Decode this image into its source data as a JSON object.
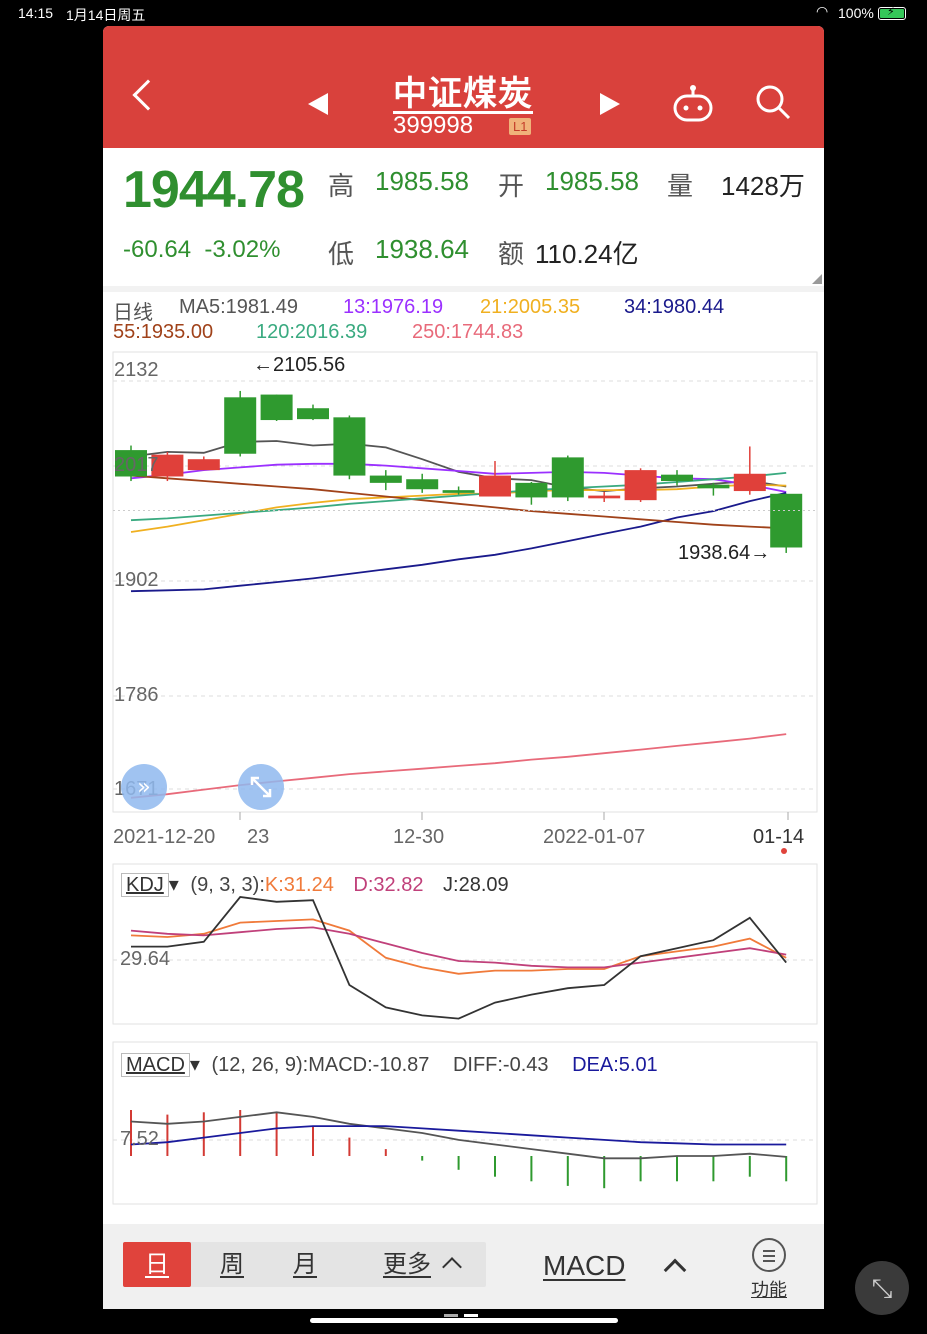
{
  "status_bar": {
    "time": "14:15",
    "date": "1月14日周五",
    "battery": "100%"
  },
  "header": {
    "title": "中证煤炭",
    "code": "399998",
    "level_badge": "L1",
    "bg_color": "#d9413c"
  },
  "quote": {
    "price": "1944.78",
    "change": "-60.64",
    "change_pct": "-3.02%",
    "high_label": "高",
    "high": "1985.58",
    "open_label": "开",
    "open": "1985.58",
    "volume_label": "量",
    "volume": "1428万",
    "low_label": "低",
    "low": "1938.64",
    "amount_label": "额",
    "amount": "110.24亿",
    "down_color": "#2f8f2f"
  },
  "kline": {
    "period_label": "日线",
    "ma": [
      {
        "label": "MA5:1981.49",
        "color": "#555555"
      },
      {
        "label": "13:1976.19",
        "color": "#9b30ff"
      },
      {
        "label": "21:2005.35",
        "color": "#f0b020"
      },
      {
        "label": "34:1980.44",
        "color": "#1a1a8c"
      },
      {
        "label": "55:1935.00",
        "color": "#a0421a"
      },
      {
        "label": "120:2016.39",
        "color": "#3aaa80"
      },
      {
        "label": "250:1744.83",
        "color": "#e86a7a"
      }
    ],
    "y_ticks": [
      "2132",
      "2017",
      "1902",
      "1786",
      "1671"
    ],
    "high_marker": "←2105.56",
    "low_marker": "1938.64→",
    "x_ticks": [
      "2021-12-20",
      "23",
      "12-30",
      "2022-01-07",
      "01-14"
    ]
  },
  "kdj": {
    "name": "KDJ",
    "params": "(9, 3, 3):",
    "k": "K:31.24",
    "d": "D:32.82",
    "j": "J:28.09",
    "tick": "29.64"
  },
  "macd": {
    "name": "MACD",
    "params": "(12, 26, 9):",
    "macd": "MACD:-10.87",
    "diff": "DIFF:-0.43",
    "dea": "DEA:5.01",
    "tick": "7.52"
  },
  "bottom_bar": {
    "tabs": [
      "日",
      "周",
      "月",
      "更多"
    ],
    "indicator": "MACD",
    "func_label": "功能"
  },
  "chart_data": [
    {
      "type": "candlestick",
      "title": "中证煤炭 日线",
      "x": [
        "2021-12-20",
        "2021-12-21",
        "2021-12-22",
        "2021-12-23",
        "2021-12-24",
        "2021-12-27",
        "2021-12-28",
        "2021-12-29",
        "2021-12-30",
        "2021-12-31",
        "2022-01-04",
        "2022-01-05",
        "2022-01-06",
        "2022-01-07",
        "2022-01-10",
        "2022-01-11",
        "2022-01-12",
        "2022-01-13",
        "2022-01-14"
      ],
      "open": [
        2052,
        2023,
        2030,
        2110,
        2113,
        2098,
        2088,
        2024,
        2020,
        2008,
        2001,
        2016,
        2044,
        1999,
        1997,
        2025,
        2014,
        2007,
        2004
      ],
      "close": [
        2023,
        2047,
        2042,
        2048,
        2085,
        2086,
        2024,
        2016,
        2009,
        2005,
        2024,
        2000,
        2000,
        2002,
        2030,
        2018,
        2010,
        2026,
        1945
      ],
      "high": [
        2057,
        2050,
        2045,
        2117,
        2113,
        2102,
        2090,
        2030,
        2026,
        2012,
        2040,
        2017,
        2046,
        2006,
        2032,
        2030,
        2016,
        2056,
        2004
      ],
      "low": [
        2018,
        2018,
        2030,
        2045,
        2084,
        2085,
        2020,
        2008,
        2005,
        2003,
        2022,
        1992,
        1996,
        1995,
        1995,
        2013,
        2002,
        2003,
        1939
      ],
      "series": [
        {
          "name": "MA5",
          "values": [
            2045,
            2050,
            2049,
            2061,
            2062,
            2057,
            2059,
            2055,
            2042,
            2028,
            2021,
            2019,
            2011,
            2007,
            2010,
            2012,
            2015,
            2018,
            2012
          ]
        },
        {
          "name": "MA13",
          "values": [
            2021,
            2025,
            2030,
            2033,
            2036,
            2037,
            2037,
            2035,
            2032,
            2029,
            2026,
            2027,
            2028,
            2027,
            2024,
            2021,
            2020,
            2014,
            2006
          ]
        },
        {
          "name": "MA21",
          "values": [
            1962,
            1968,
            1975,
            1982,
            1989,
            1994,
            1998,
            2000,
            2002,
            2004,
            2004,
            2007,
            2008,
            2008,
            2008,
            2009,
            2012,
            2014,
            2013
          ]
        },
        {
          "name": "MA34",
          "values": [
            1897,
            1898,
            1899,
            1903,
            1907,
            1911,
            1916,
            1921,
            1926,
            1932,
            1937,
            1944,
            1952,
            1960,
            1968,
            1978,
            1985,
            1996,
            2005
          ]
        },
        {
          "name": "MA55",
          "values": [
            2024,
            2021,
            2018,
            2015,
            2012,
            2009,
            2005,
            2001,
            1997,
            1993,
            1989,
            1985,
            1982,
            1979,
            1976,
            1973,
            1970,
            1968,
            1966
          ]
        },
        {
          "name": "MA120",
          "values": [
            1975,
            1977,
            1980,
            1983,
            1986,
            1989,
            1993,
            1996,
            1999,
            2002,
            2005,
            2008,
            2010,
            2012,
            2014,
            2017,
            2020,
            2023,
            2027
          ]
        },
        {
          "name": "MA250",
          "values": [
            1670,
            1674,
            1679,
            1684,
            1688,
            1692,
            1696,
            1699,
            1702,
            1705,
            1708,
            1712,
            1715,
            1719,
            1723,
            1727,
            1731,
            1735,
            1740
          ]
        }
      ],
      "ylim": [
        1650,
        2140
      ]
    },
    {
      "type": "line",
      "title": "KDJ",
      "series": [
        {
          "name": "K",
          "values": [
            45,
            44,
            46,
            53,
            54,
            55,
            48,
            31,
            25,
            21,
            23,
            23,
            24,
            24,
            32,
            35,
            38,
            43,
            31
          ]
        },
        {
          "name": "D",
          "values": [
            48,
            46,
            45,
            47,
            49,
            50,
            46,
            40,
            34,
            29,
            28,
            26,
            25,
            25,
            28,
            31,
            34,
            37,
            33
          ]
        },
        {
          "name": "J",
          "values": [
            38,
            38,
            41,
            69,
            66,
            67,
            14,
            0,
            -5,
            -7,
            3,
            8,
            12,
            14,
            32,
            37,
            42,
            56,
            28
          ]
        }
      ]
    },
    {
      "type": "bar",
      "title": "MACD",
      "values": [
        20,
        18,
        19,
        20,
        19,
        13,
        8,
        3,
        -2,
        -6,
        -9,
        -11,
        -13,
        -14,
        -11,
        -11,
        -11,
        -9,
        -11
      ],
      "series": [
        {
          "name": "DIFF",
          "values": [
            15,
            14,
            15,
            17,
            19,
            17,
            14,
            12,
            10,
            7,
            5,
            3,
            1,
            -1,
            -1,
            0,
            0,
            1,
            -0.4
          ]
        },
        {
          "name": "DEA",
          "values": [
            5,
            6,
            8,
            10,
            12,
            13,
            13,
            13,
            12,
            11,
            10,
            9,
            8,
            7,
            6,
            5.5,
            5,
            5,
            5
          ]
        }
      ]
    }
  ]
}
